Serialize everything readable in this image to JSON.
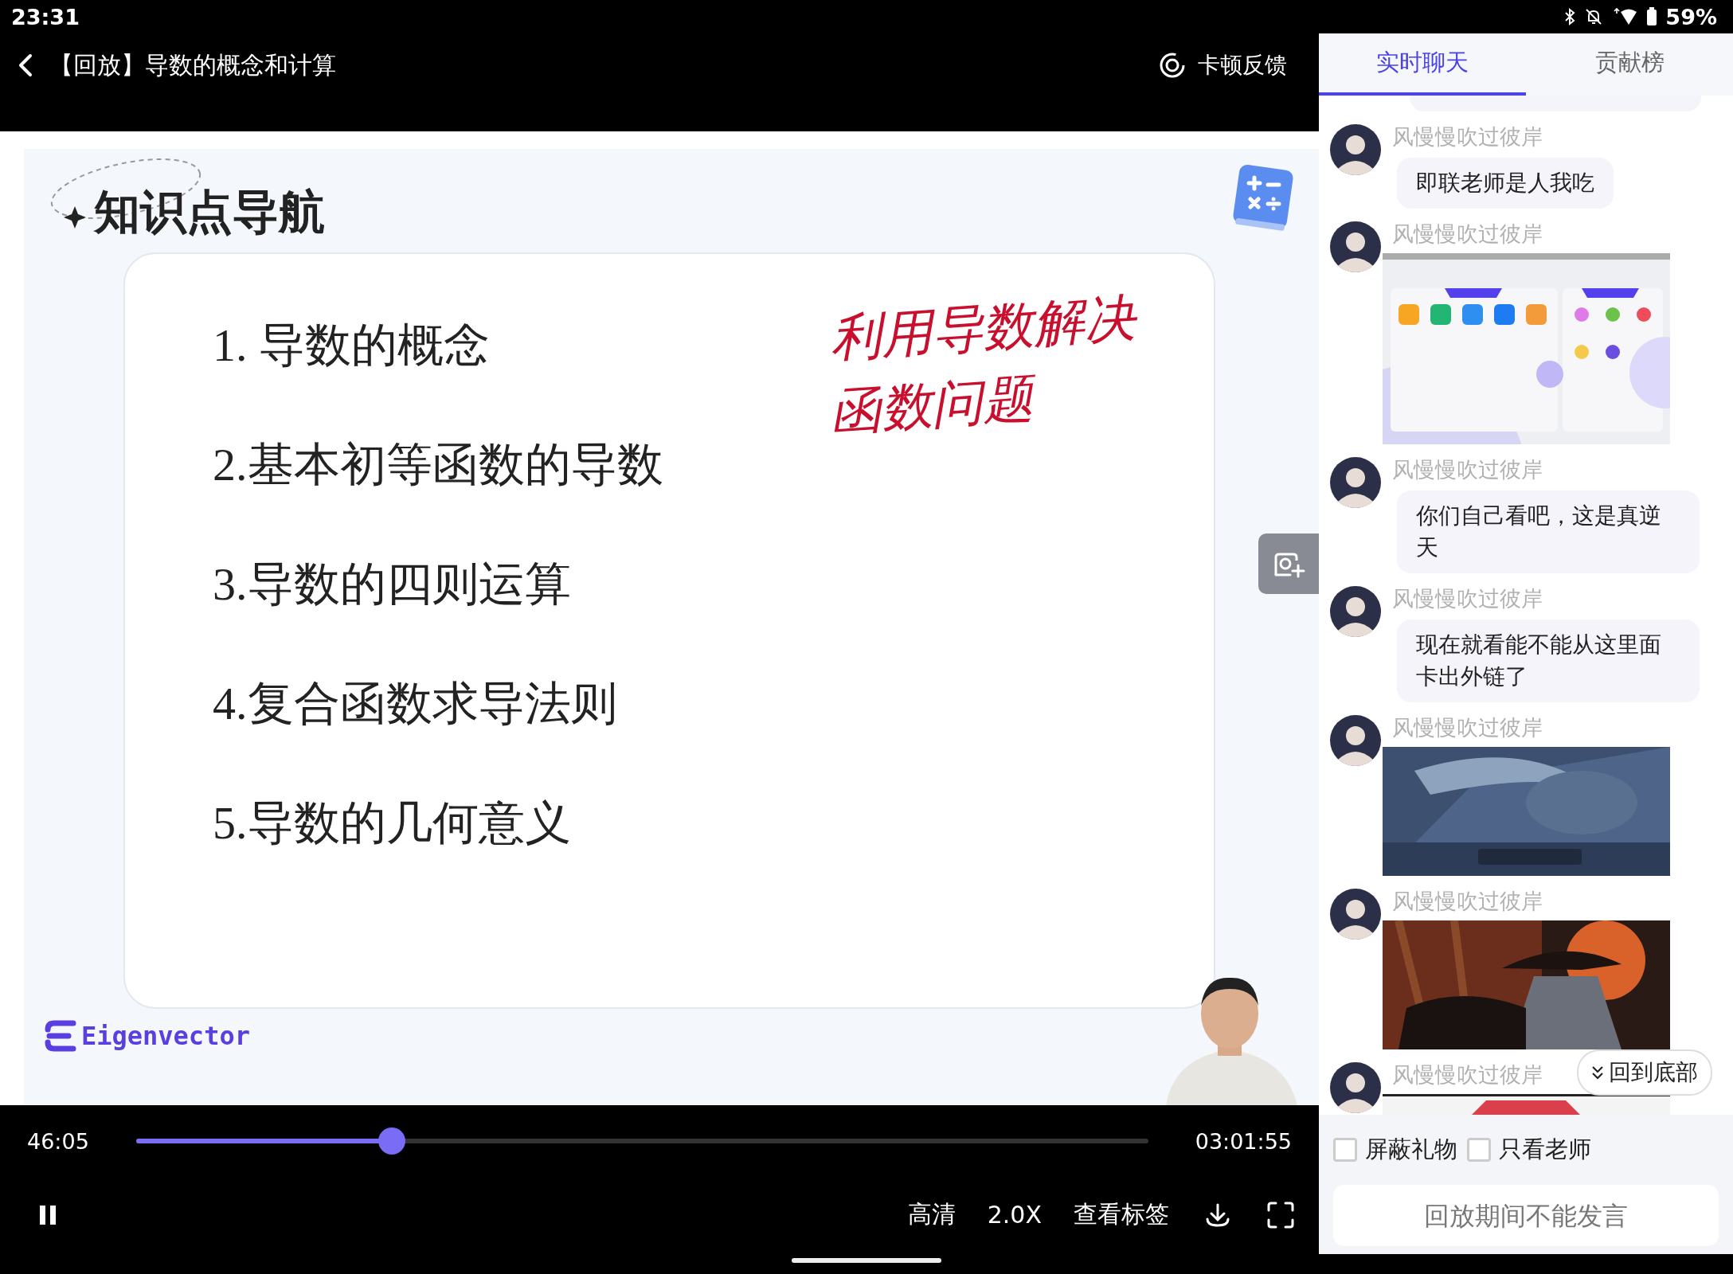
{
  "status_bar": {
    "time": "23:31",
    "battery": "59%"
  },
  "player": {
    "title": "【回放】导数的概念和计算",
    "feedback_label": "卡顿反馈",
    "slide": {
      "heading": "知识点导航",
      "items": [
        "1. 导数的概念",
        "2.基本初等函数的导数",
        "3.导数的四则运算",
        "4.复合函数求导法则",
        "5.导数的几何意义"
      ],
      "handwriting": [
        "利用导数解决",
        "函数问题"
      ],
      "brand": "Eigenvector"
    },
    "elapsed": "46:05",
    "duration": "03:01:55",
    "progress": {
      "level": 0.253
    },
    "playing": true,
    "controls": [
      {
        "label": "高清"
      },
      {
        "label": "2.0X"
      },
      {
        "label": "查看标签"
      }
    ]
  },
  "chat": {
    "tabs": [
      {
        "label": "实时聊天",
        "selected": true
      },
      {
        "label": "贡献榜",
        "selected": false
      }
    ],
    "messages": [
      {
        "user": "风慢慢吹过彼岸",
        "kind": "text",
        "text": "即联老师是人我吃"
      },
      {
        "user": "风慢慢吹过彼岸",
        "kind": "screenshot"
      },
      {
        "user": "风慢慢吹过彼岸",
        "kind": "text",
        "text": "你们自己看吧，这是真逆天"
      },
      {
        "user": "风慢慢吹过彼岸",
        "kind": "text",
        "text": "现在就看能不能从这里面卡出外链了"
      },
      {
        "user": "风慢慢吹过彼岸",
        "kind": "picture"
      },
      {
        "user": "风慢慢吹过彼岸",
        "kind": "picture"
      },
      {
        "user": "风慢慢吹过彼岸",
        "kind": "picture"
      }
    ],
    "jump_button": "回到底部",
    "filters": [
      {
        "label": "屏蔽礼物",
        "checked": false
      },
      {
        "label": "只看老师",
        "checked": false
      }
    ],
    "input": {
      "placeholder": "回放期间不能发言"
    }
  }
}
